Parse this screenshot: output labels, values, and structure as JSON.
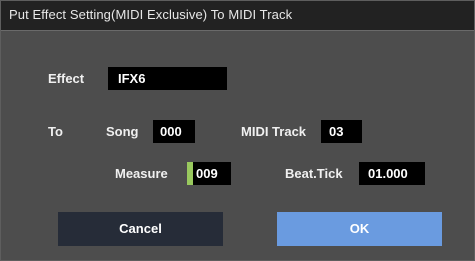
{
  "dialog": {
    "title": "Put Effect Setting(MIDI Exclusive) To MIDI Track"
  },
  "effect": {
    "label": "Effect",
    "value": "IFX6"
  },
  "to": {
    "label": "To"
  },
  "song": {
    "label": "Song",
    "value": "000"
  },
  "midi_track": {
    "label": "MIDI Track",
    "value": "03"
  },
  "measure": {
    "label": "Measure",
    "value": "009"
  },
  "beat_tick": {
    "label": "Beat.Tick",
    "value": "01.000"
  },
  "buttons": {
    "cancel_label": "Cancel",
    "ok_label": "OK"
  },
  "colors": {
    "title_bar": "#222222",
    "dialog_bg": "#4d4d4d",
    "field_bg": "#000000",
    "focus_marker": "#99c95e",
    "cancel_bg": "#262c38",
    "ok_bg": "#6a9be0"
  }
}
